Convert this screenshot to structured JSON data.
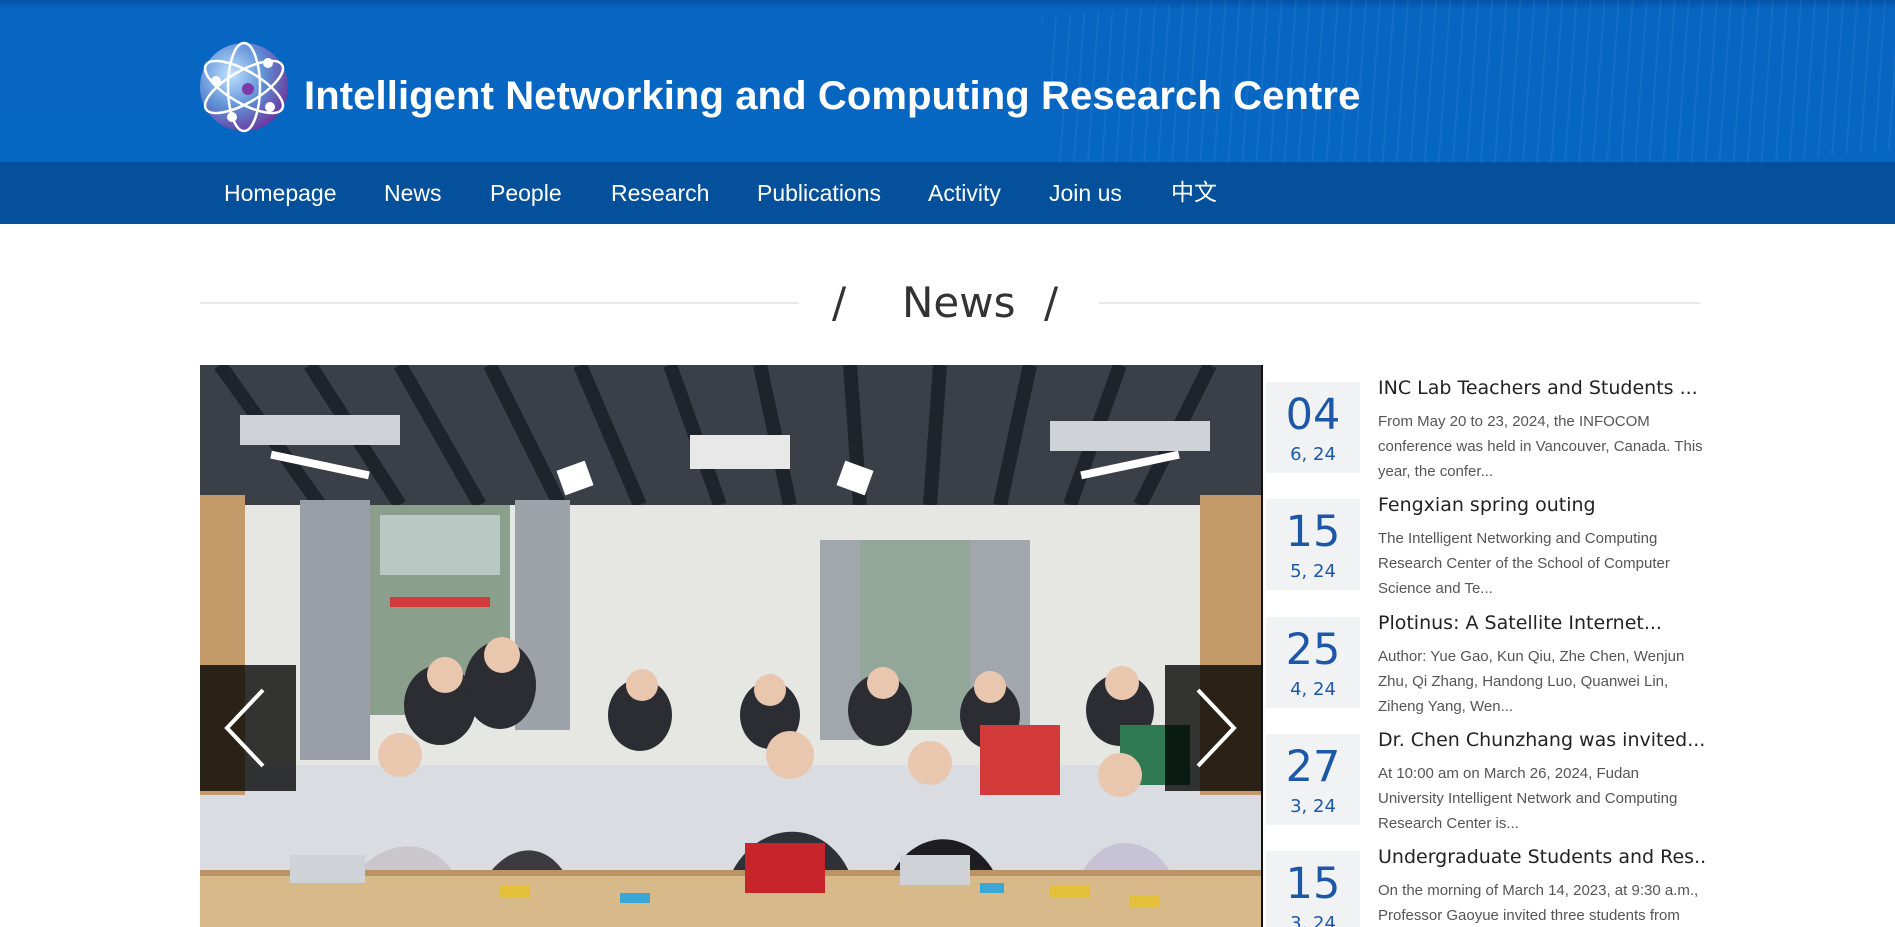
{
  "header": {
    "site_title": "Intelligent Networking and Computing Research Centre"
  },
  "nav": {
    "items": [
      {
        "label": "Homepage"
      },
      {
        "label": "News"
      },
      {
        "label": "People"
      },
      {
        "label": "Research"
      },
      {
        "label": "Publications"
      },
      {
        "label": "Activity"
      },
      {
        "label": "Join us"
      },
      {
        "label": "中文"
      }
    ]
  },
  "section": {
    "slash_left": "/",
    "title": "News",
    "slash_right": "/"
  },
  "carousel": {
    "prev_icon": "chevron-left-icon",
    "next_icon": "chevron-right-icon"
  },
  "news": [
    {
      "day": "04",
      "month_year": "6, 24",
      "title": "INC Lab Teachers and Students ...",
      "summary": "From May 20 to 23, 2024, the INFOCOM conference was held in Vancouver, Canada. This year, the confer..."
    },
    {
      "day": "15",
      "month_year": "5, 24",
      "title": "Fengxian spring outing",
      "summary": "The Intelligent Networking and Computing Research Center of the School of Computer Science and Te..."
    },
    {
      "day": "25",
      "month_year": "4, 24",
      "title": "Plotinus: A Satellite Internet...",
      "summary": "Author: Yue Gao, Kun Qiu, Zhe Chen, Wenjun Zhu, Qi Zhang, Handong Luo, Quanwei Lin, Ziheng Yang, Wen..."
    },
    {
      "day": "27",
      "month_year": "3, 24",
      "title": "Dr. Chen Chunzhang was invited...",
      "summary": "At 10:00 am on March 26, 2024, Fudan University Intelligent Network and Computing Research Center is..."
    },
    {
      "day": "15",
      "month_year": "3, 24",
      "title": "Undergraduate Students and Res...",
      "summary": "On the morning of March 14, 2023, at 9:30 a.m., Professor Gaoyue invited three students from"
    }
  ],
  "colors": {
    "header_blue": "#0667c3",
    "nav_blue": "#04509a",
    "date_blue": "#1d58a8"
  }
}
